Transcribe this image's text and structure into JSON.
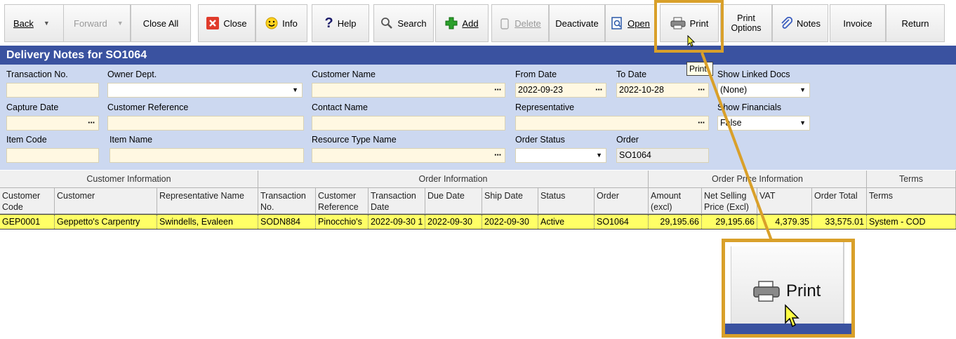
{
  "toolbar": {
    "back": "Back",
    "forward": "Forward",
    "close_all": "Close All",
    "close": "Close",
    "info": "Info",
    "help": "Help",
    "search": "Search",
    "add": "Add",
    "delete": "Delete",
    "deactivate": "Deactivate",
    "open": "Open",
    "print": "Print",
    "print_options_1": "Print",
    "print_options_2": "Options",
    "notes": "Notes",
    "invoice": "Invoice",
    "return": "Return"
  },
  "window_title": "Delivery Notes for SO1064",
  "filters": {
    "transaction_no": {
      "label": "Transaction No.",
      "value": ""
    },
    "owner_dept": {
      "label": "Owner Dept.",
      "value": ""
    },
    "customer_name": {
      "label": "Customer Name",
      "value": ""
    },
    "from_date": {
      "label": "From Date",
      "value": "2022-09-23"
    },
    "to_date": {
      "label": "To Date",
      "value": "2022-10-28"
    },
    "show_linked_docs": {
      "label": "Show Linked Docs",
      "value": "(None)"
    },
    "capture_date": {
      "label": "Capture Date",
      "value": ""
    },
    "customer_reference": {
      "label": "Customer Reference",
      "value": ""
    },
    "contact_name": {
      "label": "Contact Name",
      "value": ""
    },
    "representative": {
      "label": "Representative",
      "value": ""
    },
    "show_financials": {
      "label": "Show Financials",
      "value": "False"
    },
    "item_code": {
      "label": "Item Code",
      "value": ""
    },
    "item_name": {
      "label": "Item Name",
      "value": ""
    },
    "resource_type_name": {
      "label": "Resource Type Name",
      "value": ""
    },
    "order_status": {
      "label": "Order Status",
      "value": ""
    },
    "order": {
      "label": "Order",
      "value": "SO1064"
    }
  },
  "grid": {
    "groups": [
      "Customer Information",
      "Order Information",
      "Order Price Information",
      "Terms"
    ],
    "columns": [
      "Customer Code",
      "Customer",
      "Representative Name",
      "Transaction No.",
      "Customer Reference",
      "Transaction Date",
      "Due Date",
      "Ship Date",
      "Status",
      "Order",
      "Amount (excl)",
      "Net Selling Price (Excl)",
      "VAT",
      "Order Total",
      "Terms"
    ],
    "rows": [
      [
        "GEP0001",
        "Geppetto's Carpentry",
        "Swindells, Evaleen",
        "SODN884",
        "Pinocchio's",
        "2022-09-30 1",
        "2022-09-30",
        "2022-09-30",
        "Active",
        "SO1064",
        "29,195.66",
        "29,195.66",
        "4,379.35",
        "33,575.01",
        "System - COD"
      ]
    ]
  },
  "tooltip": "Print",
  "zoom_label": "Print",
  "colors": {
    "title_bar": "#3a52a0",
    "panel": "#ccd8f0",
    "input": "#fff8e2",
    "row_highlight": "#ffff66",
    "callout": "#d9a02a"
  }
}
